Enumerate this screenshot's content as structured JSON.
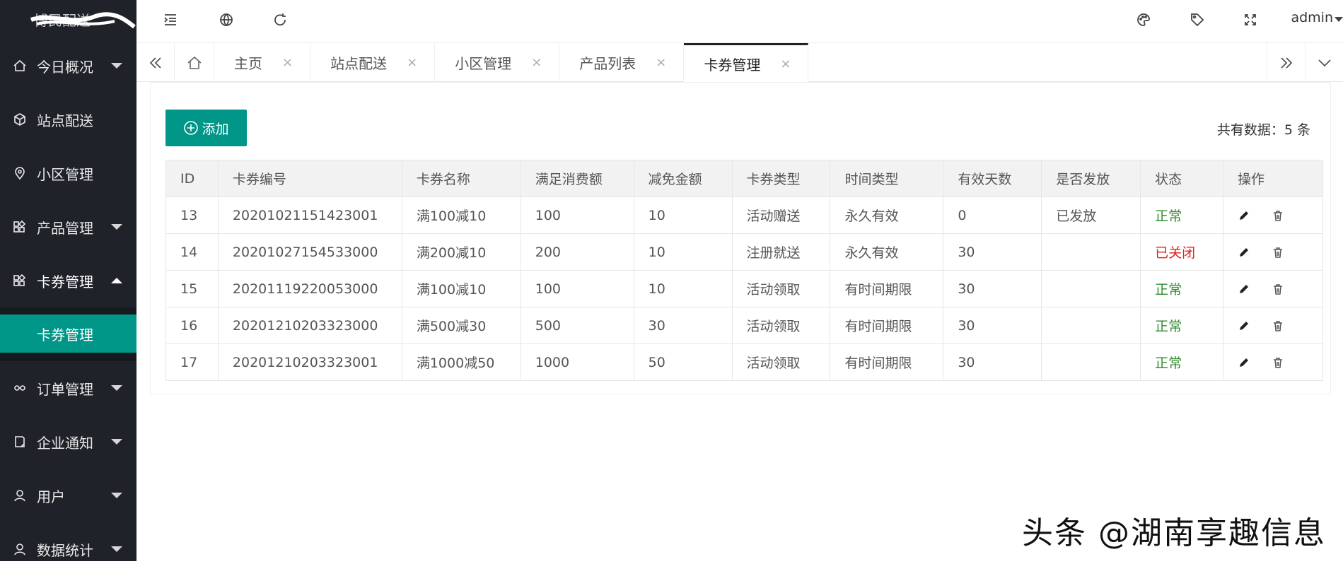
{
  "sidebar": {
    "logo": "博民配送",
    "items": [
      {
        "label": "今日概况",
        "icon": "home-icon",
        "caret": true
      },
      {
        "label": "站点配送",
        "icon": "cube-icon",
        "caret": false
      },
      {
        "label": "小区管理",
        "icon": "location-icon",
        "caret": false
      },
      {
        "label": "产品管理",
        "icon": "grid-icon",
        "caret": true
      },
      {
        "label": "卡券管理",
        "icon": "grid-icon",
        "caret": true,
        "open": true
      },
      {
        "label": "订单管理",
        "icon": "link-icon",
        "caret": true
      },
      {
        "label": "企业通知",
        "icon": "note-icon",
        "caret": true
      },
      {
        "label": "用户",
        "icon": "user-icon",
        "caret": true
      },
      {
        "label": "数据统计",
        "icon": "user-icon",
        "caret": true
      }
    ],
    "submenu_active": "卡券管理"
  },
  "header": {
    "user": "admin",
    "icons": [
      "menu-fold-icon",
      "globe-icon",
      "refresh-icon",
      "palette-icon",
      "tag-icon",
      "fullscreen-icon"
    ]
  },
  "tabs": {
    "items": [
      {
        "label": "主页"
      },
      {
        "label": "站点配送"
      },
      {
        "label": "小区管理"
      },
      {
        "label": "产品列表"
      },
      {
        "label": "卡券管理",
        "active": true
      }
    ],
    "close_glyph": "×"
  },
  "toolbar": {
    "add_label": "添加",
    "total_text": "共有数据：5 条"
  },
  "table": {
    "headers": [
      "ID",
      "卡券编号",
      "卡券名称",
      "满足消费额",
      "减免金额",
      "卡券类型",
      "时间类型",
      "有效天数",
      "是否发放",
      "状态",
      "操作"
    ],
    "rows": [
      [
        "13",
        "20201021151423001",
        "满100减10",
        "100",
        "10",
        "活动赠送",
        "永久有效",
        "0",
        "已发放",
        "正常"
      ],
      [
        "14",
        "20201027154533000",
        "满200减10",
        "200",
        "10",
        "注册就送",
        "永久有效",
        "30",
        "",
        "已关闭"
      ],
      [
        "15",
        "20201119220053000",
        "满100减10",
        "100",
        "10",
        "活动领取",
        "有时间期限",
        "30",
        "",
        "正常"
      ],
      [
        "16",
        "20201210203323000",
        "满500减30",
        "500",
        "30",
        "活动领取",
        "有时间期限",
        "30",
        "",
        "正常"
      ],
      [
        "17",
        "20201210203323001",
        "满1000减50",
        "1000",
        "50",
        "活动领取",
        "有时间期限",
        "30",
        "",
        "正常"
      ]
    ],
    "status_colors": {
      "正常": "#2e8b2e",
      "已关闭": "#e02020"
    }
  },
  "watermark": "头条 @湖南享趣信息"
}
